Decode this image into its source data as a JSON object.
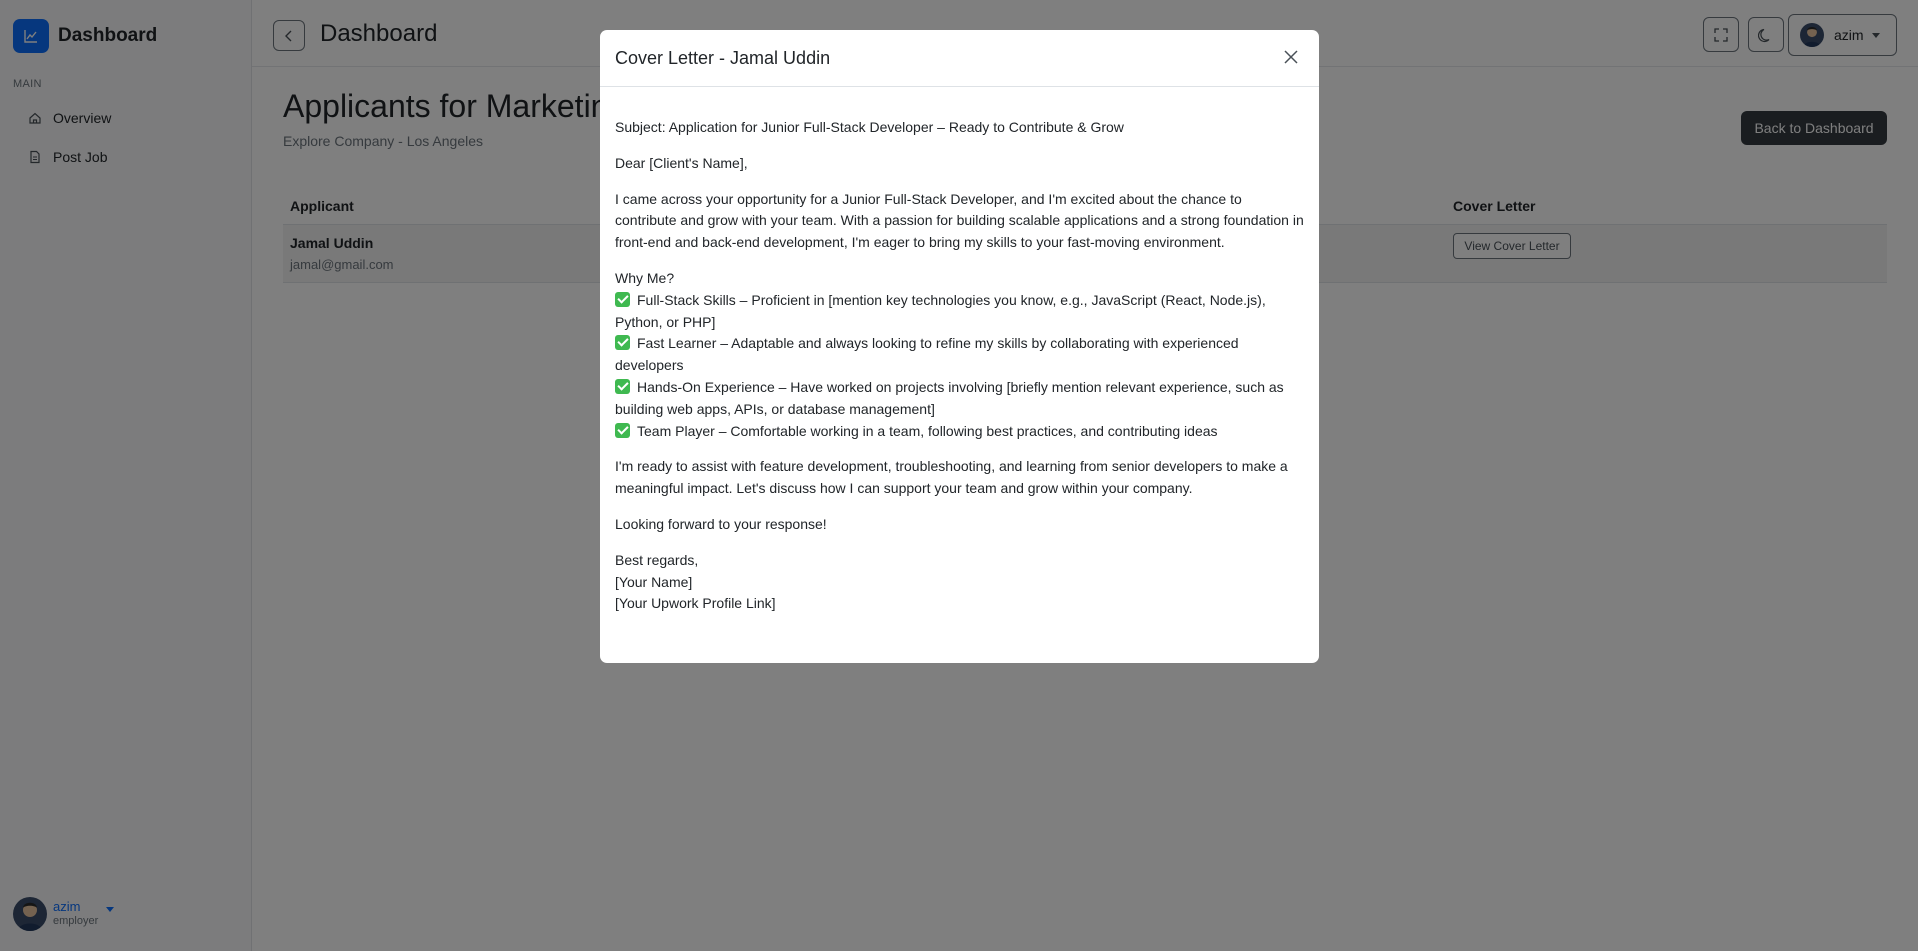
{
  "sidebar": {
    "brand": "Dashboard",
    "section_label": "MAIN",
    "items": [
      {
        "label": "Overview",
        "icon": "home-icon"
      },
      {
        "label": "Post Job",
        "icon": "file-icon"
      }
    ],
    "user": {
      "name": "azim",
      "role": "employer"
    }
  },
  "header": {
    "title": "Dashboard",
    "user_name": "azim"
  },
  "main": {
    "heading": "Applicants for Marketing",
    "subtitle": "Explore Company - Los Angeles",
    "back_button": "Back to Dashboard",
    "table": {
      "columns": [
        "Applicant",
        "Cover Letter"
      ],
      "rows": [
        {
          "name": "Jamal Uddin",
          "email": "jamal@gmail.com",
          "action": "View Cover Letter"
        }
      ]
    }
  },
  "modal": {
    "title": "Cover Letter - Jamal Uddin",
    "subject": "Subject: Application for Junior Full-Stack Developer – Ready to Contribute & Grow",
    "greeting": "Dear [Client's Name],",
    "intro": "I came across your opportunity for a Junior Full-Stack Developer, and I'm excited about the chance to contribute and grow with your team. With a passion for building scalable applications and a strong foundation in front-end and back-end development, I'm eager to bring my skills to your fast-moving environment.",
    "why_heading": "Why Me?",
    "points": [
      "Full-Stack Skills – Proficient in [mention key technologies you know, e.g., JavaScript (React, Node.js), Python, or PHP]",
      "Fast Learner – Adaptable and always looking to refine my skills by collaborating with experienced developers",
      "Hands-On Experience – Have worked on projects involving [briefly mention relevant experience, such as building web apps, APIs, or database management]",
      "Team Player – Comfortable working in a team, following best practices, and contributing ideas"
    ],
    "closing": "I'm ready to assist with feature development, troubleshooting, and learning from senior developers to make a meaningful impact. Let's discuss how I can support your team and grow within your company.",
    "looking_forward": "Looking forward to your response!",
    "signoff": "Best regards,",
    "name_placeholder": "[Your Name]",
    "profile_placeholder": "[Your Upwork Profile Link]"
  },
  "colors": {
    "accent": "#0d6efd",
    "dark_button": "#343a40",
    "check_green": "#3fb950"
  }
}
